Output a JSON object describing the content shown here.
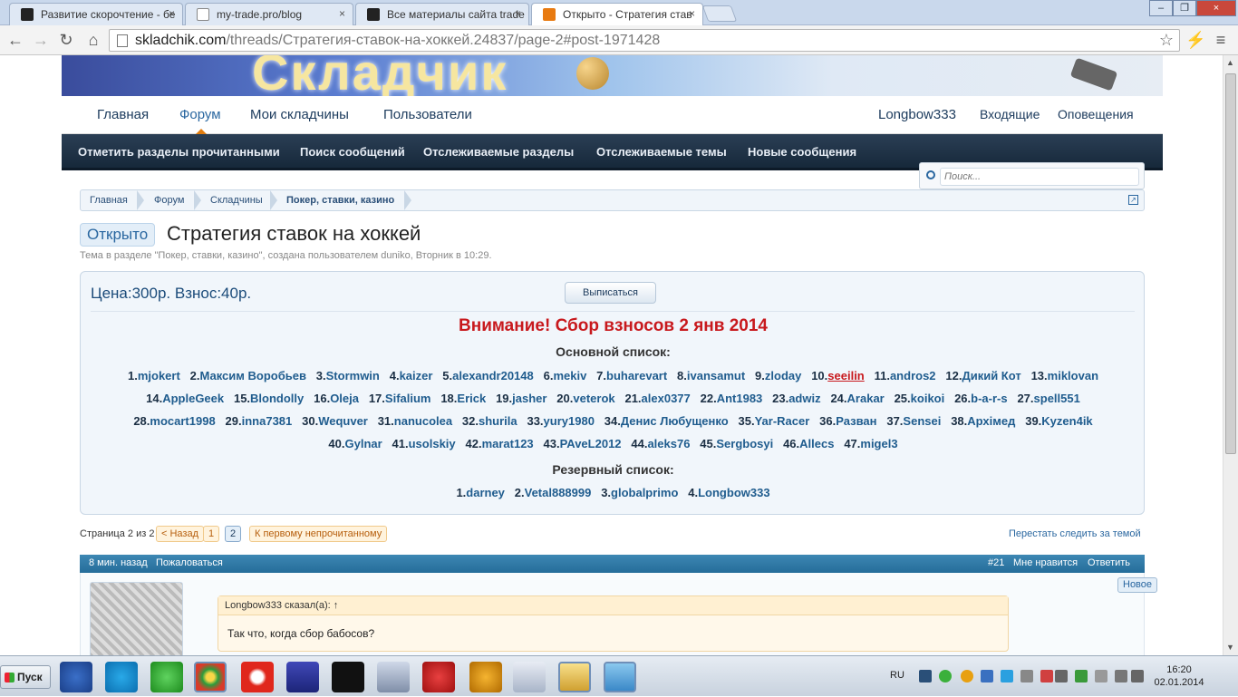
{
  "browser": {
    "tabs": [
      {
        "label": "Развитие скорочтение - бе",
        "active": false
      },
      {
        "label": "my-trade.pro/blog",
        "active": false
      },
      {
        "label": "Все материалы сайта trade",
        "active": false
      },
      {
        "label": "Открыто - Стратегия став",
        "active": true
      }
    ],
    "url_host": "skladchik.com",
    "url_path": "/threads/Стратегия-ставок-на-хоккей.24837/page-2#post-1971428",
    "close_glyph": "×"
  },
  "site": {
    "logo_text": "Складчик",
    "nav": {
      "home": "Главная",
      "forum": "Форум",
      "my": "Мои складчины",
      "users": "Пользователи",
      "account": "Longbow333",
      "inbox": "Входящие",
      "alerts": "Оповещения"
    },
    "subnav": [
      "Отметить разделы прочитанными",
      "Поиск сообщений",
      "Отслеживаемые разделы",
      "Отслеживаемые темы",
      "Новые сообщения"
    ],
    "search_placeholder": "Поиск..."
  },
  "breadcrumb": [
    "Главная",
    "Форум",
    "Складчины",
    "Покер, ставки, казино"
  ],
  "thread": {
    "prefix": "Открыто",
    "title": "Стратегия ставок на хоккей",
    "meta": "Тема в разделе \"Покер, ставки, казино\", создана пользователем duniko, Вторник в 10:29."
  },
  "notice": {
    "price": "Цена:300р.  Взнос:40р.",
    "unsubscribe": "Выписаться",
    "alert": "Внимание! Сбор взносов 2 янв 2014",
    "main_header": "Основной список:",
    "reserve_header": "Резервный список:",
    "main_list": [
      [
        "1.",
        "mjokert"
      ],
      [
        "2.",
        "Максим Воробьев"
      ],
      [
        "3.",
        "Stormwin"
      ],
      [
        "4.",
        "kaizer"
      ],
      [
        "5.",
        "alexandr20148"
      ],
      [
        "6.",
        "mekiv"
      ],
      [
        "7.",
        "buharevart"
      ],
      [
        "8.",
        "ivansamut"
      ],
      [
        "9.",
        "zloday"
      ],
      [
        "10.",
        "seeilin"
      ],
      [
        "11.",
        "andros2"
      ],
      [
        "12.",
        "Дикий Кот"
      ],
      [
        "13.",
        "miklovan"
      ],
      [
        "14.",
        "AppleGeek"
      ],
      [
        "15.",
        "Blondolly"
      ],
      [
        "16.",
        "Oleja"
      ],
      [
        "17.",
        "Sifalium"
      ],
      [
        "18.",
        "Erick"
      ],
      [
        "19.",
        "jasher"
      ],
      [
        "20.",
        "veterok"
      ],
      [
        "21.",
        "alex0377"
      ],
      [
        "22.",
        "Ant1983"
      ],
      [
        "23.",
        "adwiz"
      ],
      [
        "24.",
        "Arakar"
      ],
      [
        "25.",
        "koikoi"
      ],
      [
        "26.",
        "b-a-r-s"
      ],
      [
        "27.",
        "spell551"
      ],
      [
        "28.",
        "mocart1998"
      ],
      [
        "29.",
        "inna7381"
      ],
      [
        "30.",
        "Wequver"
      ],
      [
        "31.",
        "nanucolea"
      ],
      [
        "32.",
        "shurila"
      ],
      [
        "33.",
        "yury1980"
      ],
      [
        "34.",
        "Денис Любущенко"
      ],
      [
        "35.",
        "Yar-Racer"
      ],
      [
        "36.",
        "Разван"
      ],
      [
        "37.",
        "Sensei"
      ],
      [
        "38.",
        "Архімед"
      ],
      [
        "39.",
        "Kyzen4ik"
      ],
      [
        "40.",
        "Gylnar"
      ],
      [
        "41.",
        "usolskiy"
      ],
      [
        "42.",
        "marat123"
      ],
      [
        "43.",
        "PAveL2012"
      ],
      [
        "44.",
        "aleks76"
      ],
      [
        "45.",
        "Sergbosyi"
      ],
      [
        "46.",
        "Allecs"
      ],
      [
        "47.",
        "migel3"
      ]
    ],
    "rows": [
      [
        0,
        13
      ],
      [
        13,
        27
      ],
      [
        27,
        39
      ],
      [
        39,
        47
      ]
    ],
    "reserve_list": [
      [
        "1.",
        "darney"
      ],
      [
        "2.",
        "Vetal888999"
      ],
      [
        "3.",
        "globalprimo"
      ],
      [
        "4.",
        "Longbow333"
      ]
    ],
    "highlight_user": "seeilin"
  },
  "pager": {
    "label": "Страница 2 из 2",
    "prev": "< Назад",
    "p1": "1",
    "p2": "2",
    "first_unread": "К первому непрочитанному",
    "stop_watch": "Перестать следить за темой"
  },
  "post": {
    "time": "8 мин. назад",
    "report": "Пожаловаться",
    "num": "#21",
    "like": "Мне нравится",
    "reply": "Ответить",
    "new_badge": "Новое",
    "quote_head": "Longbow333 сказал(а): ↑",
    "quote_text": "Так что, когда сбор бабосов?"
  },
  "taskbar": {
    "start": "Пуск",
    "lang": "RU",
    "time": "16:20",
    "date": "02.01.2014"
  },
  "colors": {
    "accent": "#2a67a0",
    "alert": "#c8191d",
    "orange": "#e27d10"
  }
}
